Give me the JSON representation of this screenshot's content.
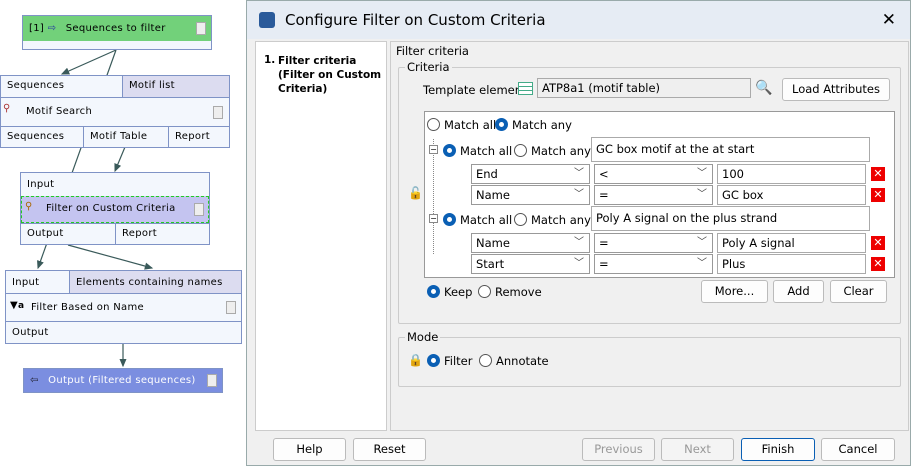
{
  "workflow": {
    "input_node": {
      "index": "[1]",
      "label": "Sequences to filter"
    },
    "motif_search": {
      "inputs": [
        "Sequences",
        "Motif list"
      ],
      "label": "Motif Search",
      "outputs": [
        "Sequences",
        "Motif Table",
        "Report"
      ]
    },
    "custom_filter": {
      "inputs": [
        "Input"
      ],
      "label": "Filter on Custom Criteria",
      "outputs": [
        "Output",
        "Report"
      ]
    },
    "name_filter": {
      "inputs": [
        "Input",
        "Elements containing names"
      ],
      "label": "Filter Based on Name",
      "outputs": [
        "Output"
      ]
    },
    "output_node": {
      "label": "Output (Filtered sequences)"
    }
  },
  "dialog": {
    "title": "Configure Filter on Custom Criteria",
    "steps": [
      {
        "num": "1.",
        "label": "Filter criteria (Filter on Custom Criteria)"
      }
    ],
    "panel_title": "Filter criteria",
    "criteria": {
      "legend": "Criteria",
      "template_label": "Template element",
      "template_value": "ATP8a1 (motif table)",
      "load_attributes": "Load Attributes",
      "top_match": {
        "all": "Match all",
        "any": "Match any",
        "selected": "any"
      },
      "groups": [
        {
          "match_all": "Match all",
          "match_any": "Match any",
          "selected": "all",
          "description": "GC box motif at the at start",
          "rows": [
            {
              "field": "End",
              "op": "<",
              "value": "100"
            },
            {
              "field": "Name",
              "op": "=",
              "value": "GC box"
            }
          ]
        },
        {
          "match_all": "Match all",
          "match_any": "Match any",
          "selected": "all",
          "description": "Poly A signal on the plus strand",
          "rows": [
            {
              "field": "Name",
              "op": "=",
              "value": "Poly A signal"
            },
            {
              "field": "Start",
              "op": "=",
              "value": "Plus"
            }
          ]
        }
      ],
      "keep": "Keep",
      "remove": "Remove",
      "action_selected": "keep",
      "more": "More...",
      "add": "Add",
      "clear": "Clear"
    },
    "mode": {
      "legend": "Mode",
      "filter": "Filter",
      "annotate": "Annotate",
      "selected": "filter"
    },
    "buttons": {
      "help": "Help",
      "reset": "Reset",
      "previous": "Previous",
      "next": "Next",
      "finish": "Finish",
      "cancel": "Cancel"
    },
    "colors": {
      "accent": "#0a5fb4",
      "delete": "#e00000",
      "input_node": "#72d17a",
      "output_node": "#7b8ee0",
      "selected_node": "#c4c4f0"
    }
  }
}
